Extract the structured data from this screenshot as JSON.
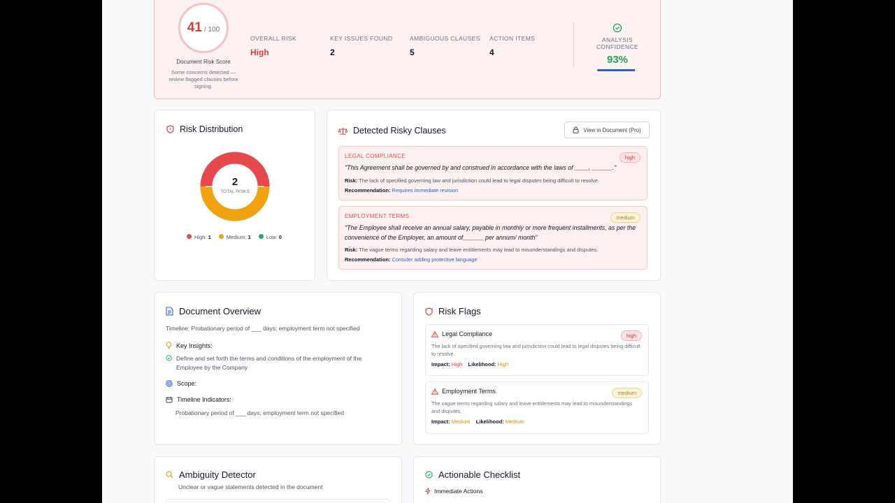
{
  "summary": {
    "score": "41",
    "score_max": "/ 100",
    "score_label": "Document Risk Score",
    "score_note": "Some concerns detected — review flagged clauses before signing.",
    "stats": [
      {
        "label": "OVERALL RISK",
        "value": "High"
      },
      {
        "label": "KEY ISSUES FOUND",
        "value": "2"
      },
      {
        "label": "AMBIGUOUS CLAUSES",
        "value": "5"
      },
      {
        "label": "ACTION ITEMS",
        "value": "4"
      }
    ],
    "confidence_label": "ANALYSIS CONFIDENCE",
    "confidence_value": "93%",
    "confidence_fraction": 0.93
  },
  "risk_distribution": {
    "title": "Risk Distribution",
    "total": "2",
    "total_label": "TOTAL RISKS",
    "legend": [
      {
        "label": "High:",
        "value": "1",
        "color": "#e5484d"
      },
      {
        "label": "Medium:",
        "value": "1",
        "color": "#f0a20f"
      },
      {
        "label": "Low:",
        "value": "0",
        "color": "#30a46c"
      }
    ]
  },
  "clauses": {
    "title": "Detected Risky Clauses",
    "view_button": "View in Document (Pro)",
    "items": [
      {
        "category": "LEGAL COMPLIANCE",
        "badge": "high",
        "quote": "\"This Agreement shall be governed by and construed in accordance with the laws of ____, ______.\"",
        "risk_label": "Risk:",
        "risk": "The lack of specified governing law and jurisdiction could lead to legal disputes being difficult to resolve.",
        "rec_label": "Recommendation:",
        "rec": "Requires immediate revision"
      },
      {
        "category": "EMPLOYMENT TERMS",
        "badge": "medium",
        "quote": "\"The Employee shall receive an annual salary, payable in monthly or more frequent installments, as per the convenience of the Employer, an amount of______ per annum/ month\"",
        "risk_label": "Risk:",
        "risk": "The vague terms regarding salary and leave entitlements may lead to misunderstandings and disputes.",
        "rec_label": "Recommendation:",
        "rec": "Consider adding protective language"
      }
    ]
  },
  "overview": {
    "title": "Document Overview",
    "timeline": "Timeline: Probationary period of ___ days; employment term not specified",
    "insights_label": "Key Insights:",
    "insight": "Define and set forth the terms and conditions of the employment of the Employee by the Company",
    "scope_label": "Scope:",
    "timeline_indicators_label": "Timeline Indicators:",
    "timeline_indicator": "Probationary period of ___ days; employment term not specified"
  },
  "risk_flags": {
    "title": "Risk Flags",
    "items": [
      {
        "title": "Legal Compliance",
        "badge": "high",
        "desc": "The lack of specified governing law and jurisdiction could lead to legal disputes being difficult to resolve.",
        "impact_label": "Impact:",
        "impact": "High",
        "likelihood_label": "Likelihood:",
        "likelihood": "High"
      },
      {
        "title": "Employment Terms",
        "badge": "medium",
        "desc": "The vague terms regarding salary and leave entitlements may lead to misunderstandings and disputes.",
        "impact_label": "Impact:",
        "impact": "Medium",
        "likelihood_label": "Likelihood:",
        "likelihood": "Medium"
      }
    ]
  },
  "ambiguity": {
    "title": "Ambiguity Detector",
    "subtitle": "Unclear or vague statements detected in the document"
  },
  "checklist": {
    "title": "Actionable Checklist",
    "section": "Immediate Actions"
  },
  "colors": {
    "accent_red": "#dc3b3b",
    "accent_amber": "#d4900c",
    "accent_green": "#22a35a",
    "link_blue": "#2f5fc4"
  }
}
